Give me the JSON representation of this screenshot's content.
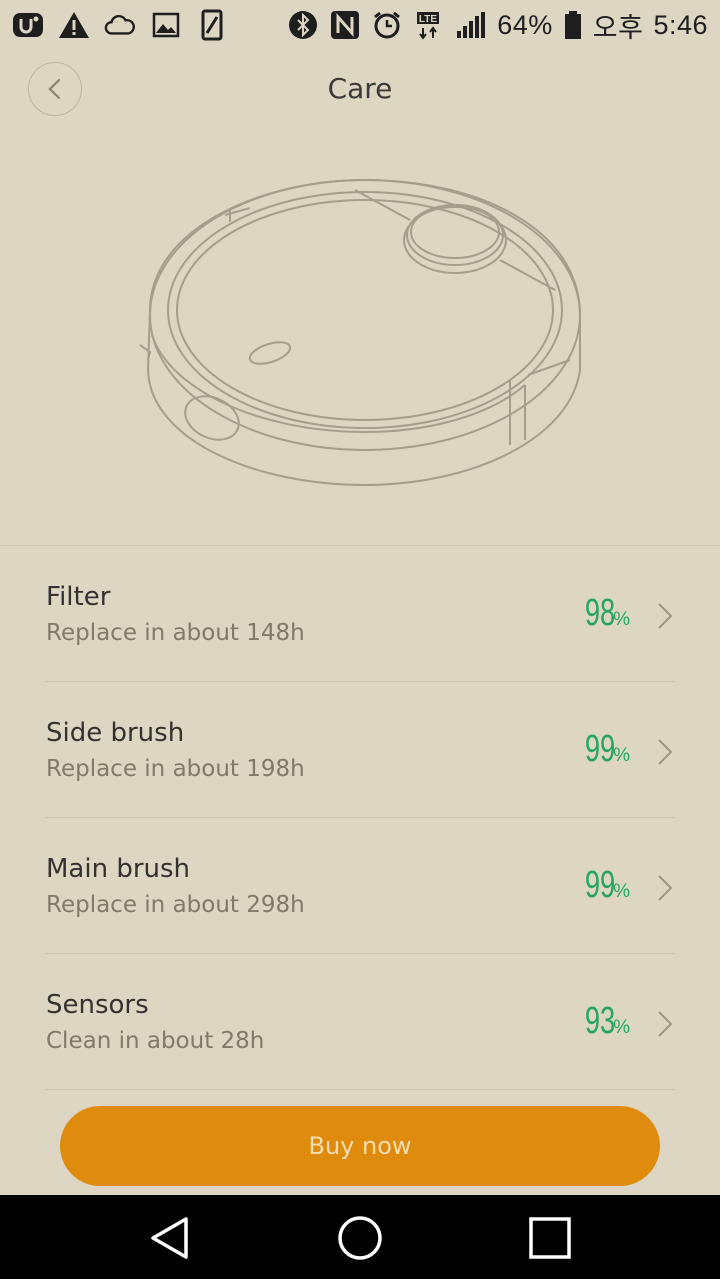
{
  "status_bar": {
    "battery_percent": "64%",
    "ampm": "오후",
    "time": "5:46",
    "network_label": "LTE"
  },
  "header": {
    "title": "Care"
  },
  "items": [
    {
      "name": "Filter",
      "sub": "Replace in about 148h",
      "percent": "98",
      "sign": "%"
    },
    {
      "name": "Side brush",
      "sub": "Replace in about 198h",
      "percent": "99",
      "sign": "%"
    },
    {
      "name": "Main brush",
      "sub": "Replace in about 298h",
      "percent": "99",
      "sign": "%"
    },
    {
      "name": "Sensors",
      "sub": "Clean in about 28h",
      "percent": "93",
      "sign": "%"
    }
  ],
  "buy_button": {
    "label": "Buy now"
  },
  "colors": {
    "background": "#dcd6c3",
    "accent_green": "#27a660",
    "button_orange": "#df8c0e"
  }
}
